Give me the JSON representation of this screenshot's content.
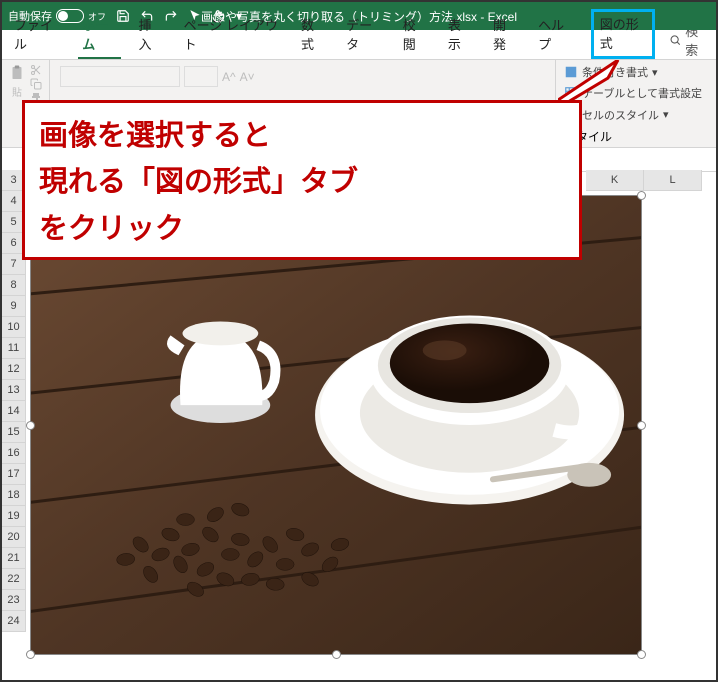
{
  "titlebar": {
    "autosave_label": "自動保存",
    "autosave_state": "オフ",
    "title": "画像や写真を丸く切り取る（トリミング）方法.xlsx - Excel"
  },
  "tabs": {
    "file": "ファイル",
    "home": "ホーム",
    "insert": "挿入",
    "pagelayout": "ページ レイアウト",
    "formulas": "数式",
    "data": "データ",
    "review": "校閲",
    "view": "表示",
    "developer": "開発",
    "help": "ヘルプ",
    "picture_format": "図の形式",
    "search": "検索"
  },
  "ribbon": {
    "clipboard": {
      "paste": "貼",
      "group_label": ""
    },
    "styles": {
      "conditional": "条件付き書式",
      "table": "テーブルとして書式設定",
      "cell_styles": "セルのスタイル",
      "group_label": "スタイル"
    }
  },
  "columns": [
    "K",
    "L"
  ],
  "rows": [
    "3",
    "4",
    "5",
    "6",
    "7",
    "8",
    "9",
    "10",
    "11",
    "12",
    "13",
    "14",
    "15",
    "16",
    "17",
    "18",
    "19",
    "20",
    "21",
    "22",
    "23",
    "24"
  ],
  "callout": {
    "text": "画像を選択すると\n現れる「図の形式」タブ\nをクリック"
  }
}
